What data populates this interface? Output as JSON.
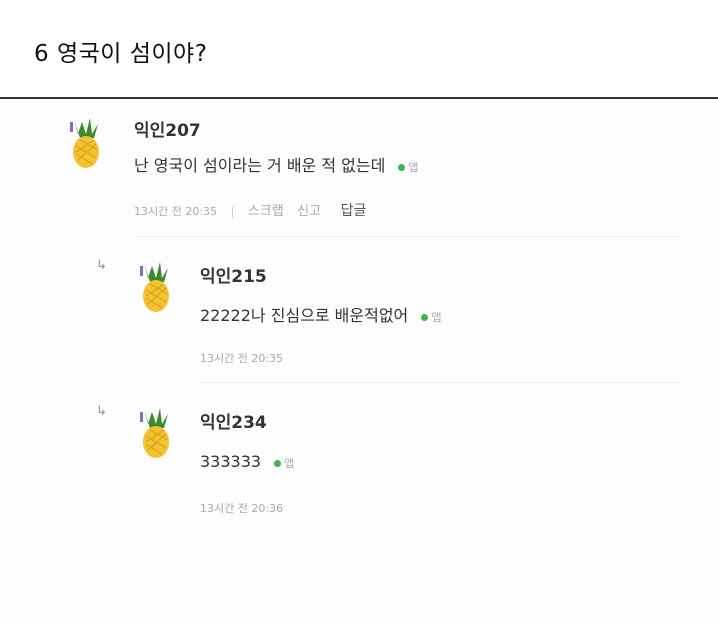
{
  "post": {
    "title": "6 영국이 섬이야?"
  },
  "comments": [
    {
      "author": "익인207",
      "text": "난 영국이 섬이라는 거 배운 적 없는데",
      "client": "앱",
      "time": "13시간 전 20:35",
      "actions": [
        "스크랩",
        "신고"
      ],
      "reply_label": "답글"
    },
    {
      "author": "익인215",
      "text": "22222나 진심으로 배운적없어",
      "client": "앱",
      "time": "13시간 전 20:35"
    },
    {
      "author": "익인234",
      "text": "333333",
      "client": "앱",
      "time": "13시간 전 20:36"
    }
  ],
  "icons": {
    "avatar": "pineapple-icon",
    "reply_arrow": "reply-arrow-icon",
    "status_dot": "green-dot-icon"
  },
  "colors": {
    "status_dot": "#3bb54a",
    "pineapple_body": "#f2c230",
    "pineapple_leaf": "#3a8a2e"
  }
}
